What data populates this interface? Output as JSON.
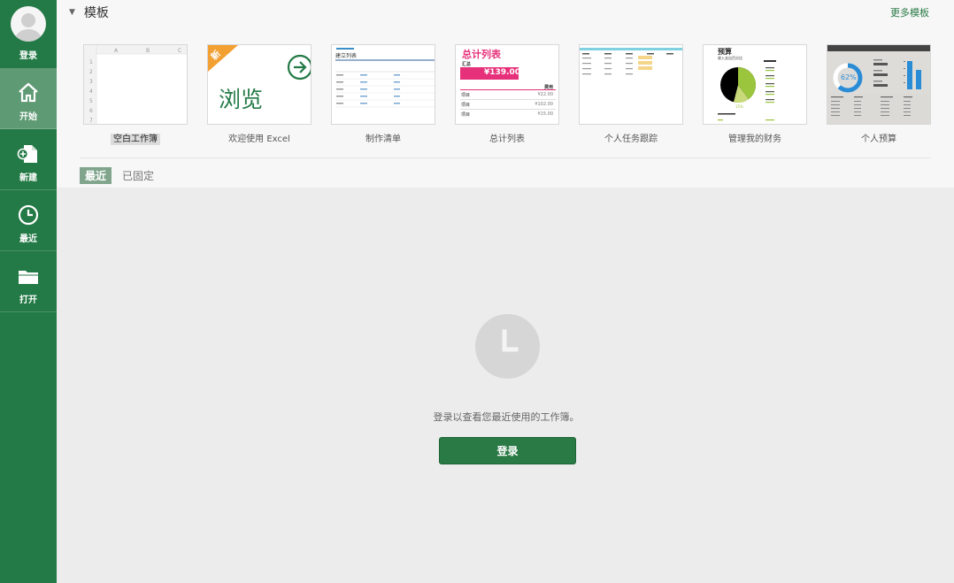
{
  "sidebar": {
    "items": [
      {
        "label": "登录",
        "icon": "avatar"
      },
      {
        "label": "开始",
        "icon": "home-icon"
      },
      {
        "label": "新建",
        "icon": "new-document-icon"
      },
      {
        "label": "最近",
        "icon": "clock-icon"
      },
      {
        "label": "打开",
        "icon": "folder-icon"
      }
    ]
  },
  "templates": {
    "title": "模板",
    "more": "更多模板",
    "items": [
      {
        "caption": "空白工作簿"
      },
      {
        "caption": "欢迎使用 Excel",
        "badge": "新",
        "browse": "浏览"
      },
      {
        "caption": "制作清单",
        "heading": "建立列表"
      },
      {
        "caption": "总计列表",
        "heading": "总计列表",
        "sub": "汇总",
        "amount": "¥139.00",
        "col": "费用",
        "rows": [
          [
            "项目",
            "¥22.00"
          ],
          [
            "项目",
            "¥102.00"
          ],
          [
            "项目",
            "¥15.00"
          ]
        ]
      },
      {
        "caption": "个人任务跟踪"
      },
      {
        "caption": "管理我的财务",
        "heading": "预算",
        "sub": "收入支出百分比",
        "pct": "15%"
      },
      {
        "caption": "个人预算",
        "pct": "62%"
      }
    ]
  },
  "tabs": {
    "recent": "最近",
    "pinned": "已固定"
  },
  "empty": {
    "message": "登录以查看您最近使用的工作簿。",
    "button": "登录"
  },
  "colors": {
    "brand": "#237a46",
    "active": "#5e9a74",
    "accent_orange": "#f3a033",
    "accent_pink": "#e6317a"
  }
}
